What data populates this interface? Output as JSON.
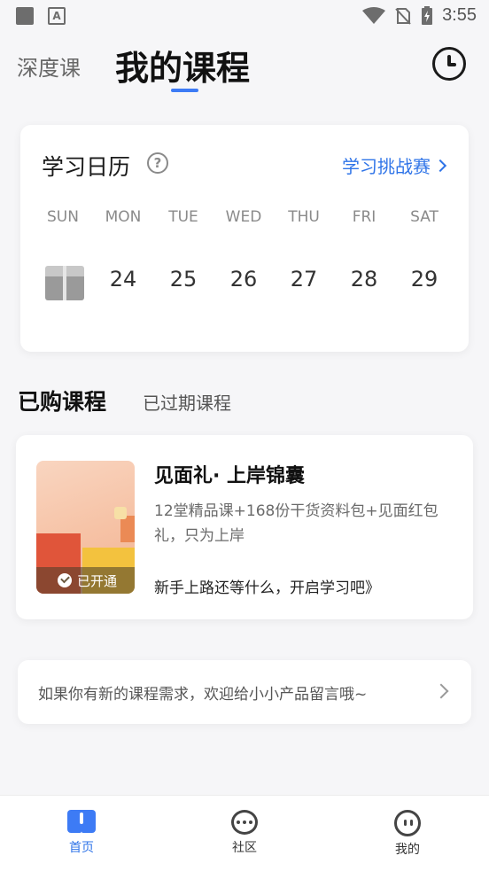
{
  "statusbar": {
    "time": "3:55"
  },
  "header": {
    "tab_inactive": "深度课",
    "tab_active": "我的课程",
    "history_icon": "clock-icon"
  },
  "calendar": {
    "title": "学习日历",
    "help_icon": "?",
    "challenge_link": "学习挑战赛",
    "weekdays": [
      "SUN",
      "MON",
      "TUE",
      "WED",
      "THU",
      "FRI",
      "SAT"
    ],
    "dates": [
      "",
      "24",
      "25",
      "26",
      "27",
      "28",
      "29"
    ],
    "sunday_icon": "gift-icon"
  },
  "sections": {
    "active": "已购课程",
    "inactive": "已过期课程"
  },
  "course": {
    "title": "见面礼· 上岸锦囊",
    "description": "12堂精品课+168份干货资料包+见面红包礼，只为上岸",
    "cta": "新手上路还等什么，开启学习吧》",
    "badge": "已开通"
  },
  "feedback": {
    "text": "如果你有新的课程需求，欢迎给小小产品留言哦~"
  },
  "bottom_nav": {
    "items": [
      {
        "label": "首页",
        "icon": "book-icon",
        "active": true
      },
      {
        "label": "社区",
        "icon": "chat-icon",
        "active": false
      },
      {
        "label": "我的",
        "icon": "face-icon",
        "active": false
      }
    ]
  },
  "colors": {
    "accent": "#3d7bf5",
    "link": "#2f74e8",
    "background": "#f6f6f8"
  }
}
